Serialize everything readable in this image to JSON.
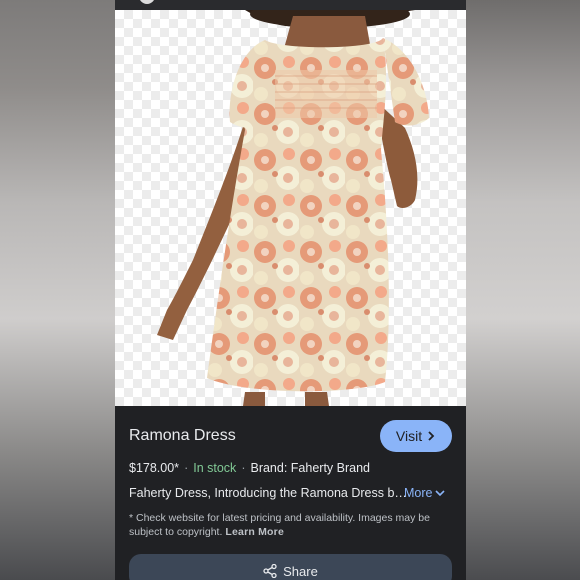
{
  "product": {
    "name": "Ramona Dress",
    "visit_label": "Visit",
    "price": "$178.00*",
    "stock": "In stock",
    "brand": "Brand: Faherty Brand",
    "description": "Faherty Dress, Introducing the Ramona Dress b…",
    "more_label": "More",
    "disclaimer": "* Check website for latest pricing and availability. Images may be subject to copyright.",
    "learn_more_label": "Learn More",
    "share_label": "Share"
  },
  "colors": {
    "panel_bg": "#202124",
    "accent_blue": "#8ab4f8",
    "stock_green": "#81c995",
    "share_bg": "#3c4757"
  },
  "icons": {
    "visit": "chevron-right-icon",
    "more": "chevron-down-icon",
    "share": "share-icon"
  }
}
